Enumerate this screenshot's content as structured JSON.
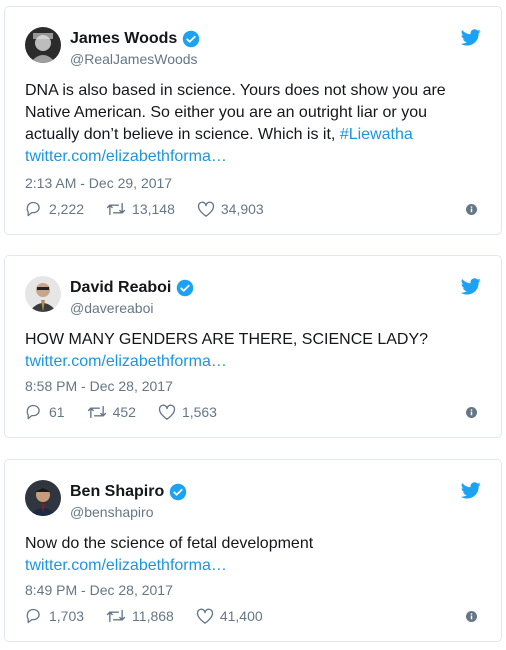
{
  "tweets": [
    {
      "name": "James Woods",
      "handle": "@RealJamesWoods",
      "text": "DNA is also based in science. Yours does not show you are Native American. So either you are an outright liar or you actually don’t believe in science. Which is it, ",
      "hashtag": "#Liewatha",
      "link": "twitter.com/elizabethforma…",
      "time": "2:13 AM - Dec 29, 2017",
      "replies": "2,222",
      "retweets": "13,148",
      "likes": "34,903"
    },
    {
      "name": "David Reaboi",
      "handle": "@davereaboi",
      "text": "HOW MANY GENDERS ARE THERE, SCIENCE LADY?",
      "link": "twitter.com/elizabethforma…",
      "time": "8:58 PM - Dec 28, 2017",
      "replies": "61",
      "retweets": "452",
      "likes": "1,563"
    },
    {
      "name": "Ben Shapiro",
      "handle": "@benshapiro",
      "text": "Now do the science of fetal development",
      "link": "twitter.com/elizabethforma…",
      "time": "8:49 PM - Dec 28, 2017",
      "replies": "1,703",
      "retweets": "11,868",
      "likes": "41,400"
    }
  ],
  "colors": {
    "accent": "#1da1f2",
    "link": "#1b95e0",
    "muted": "#657786",
    "border": "#e1e8ed"
  },
  "icons": [
    "twitter-bird-icon",
    "verified-badge-icon",
    "reply-icon",
    "retweet-icon",
    "like-icon",
    "info-icon"
  ]
}
